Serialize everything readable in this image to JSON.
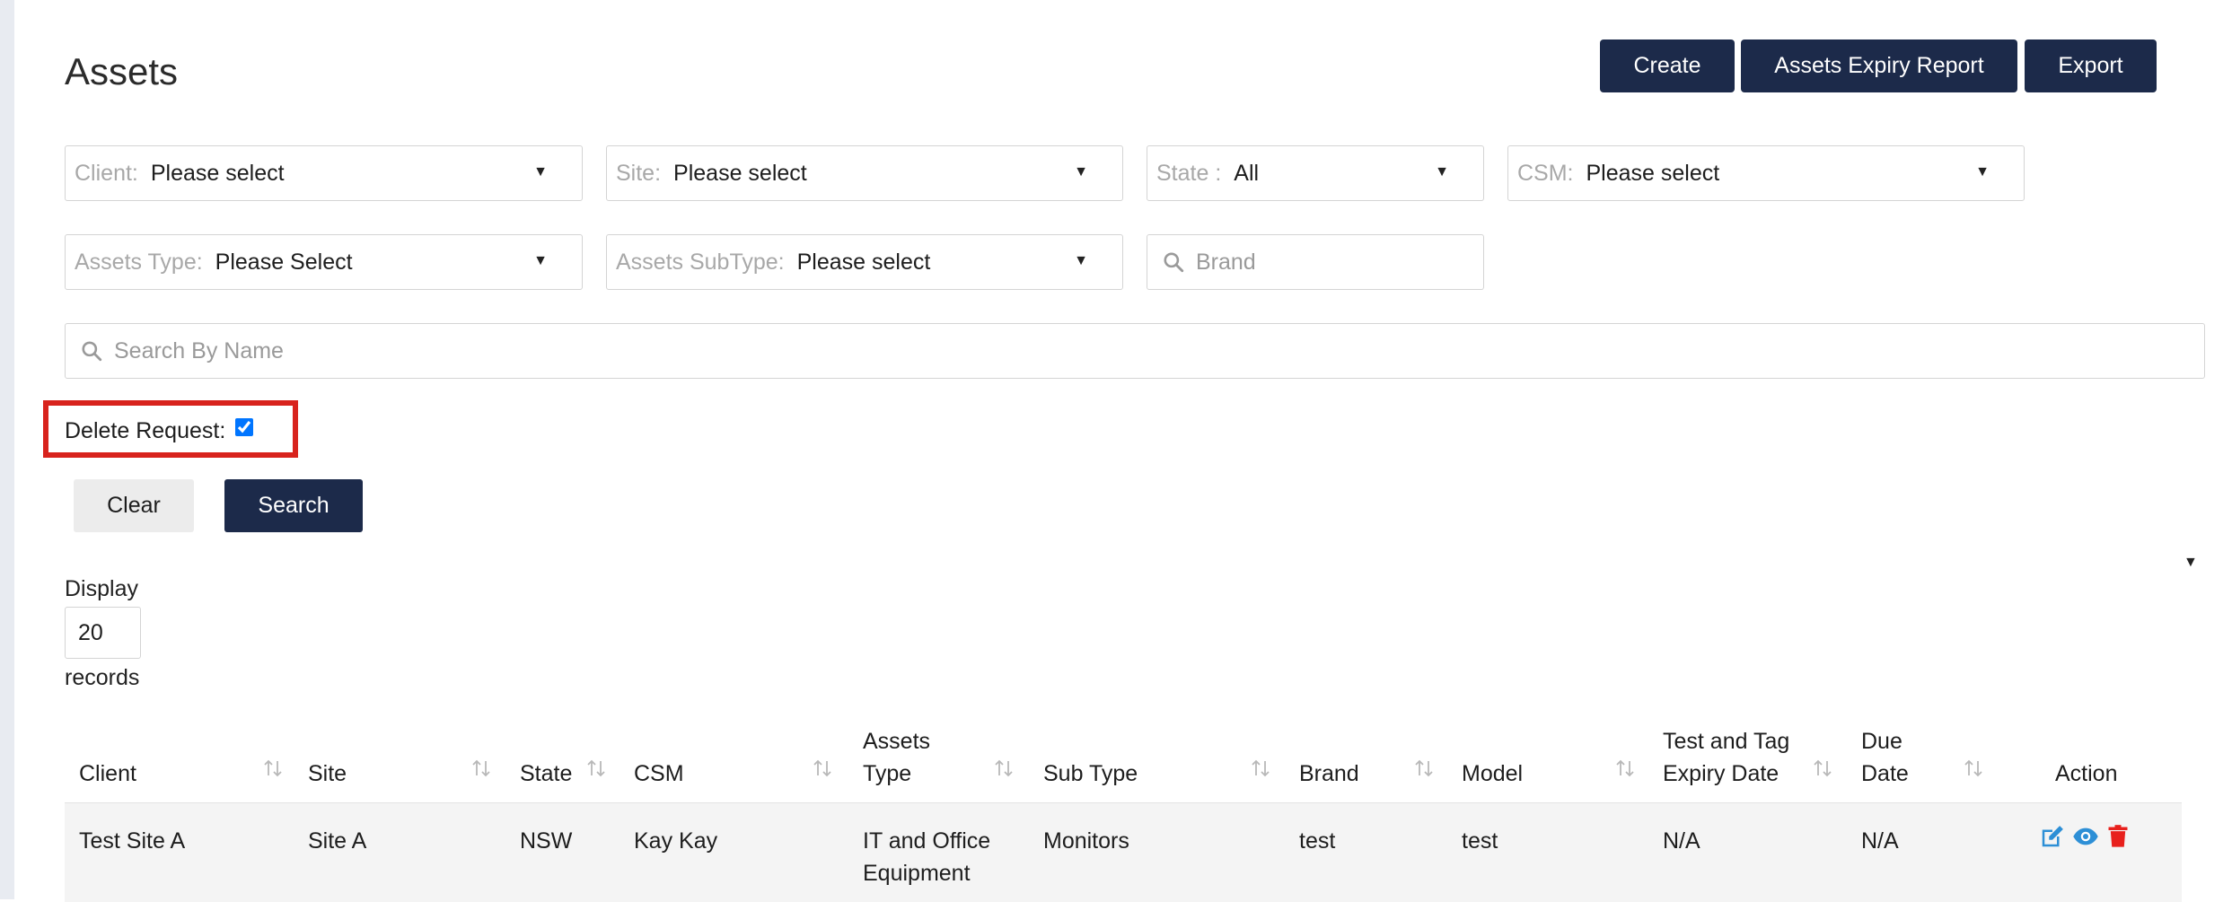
{
  "page": {
    "title": "Assets"
  },
  "toolbar": {
    "create_label": "Create",
    "expiry_report_label": "Assets Expiry Report",
    "export_label": "Export"
  },
  "filters": {
    "client": {
      "label": "Client:",
      "value": "Please select"
    },
    "site": {
      "label": "Site:",
      "value": "Please select"
    },
    "state": {
      "label": "State :",
      "value": "All"
    },
    "csm": {
      "label": "CSM:",
      "value": "Please select"
    },
    "assets_type": {
      "label": "Assets Type:",
      "value": "Please Select"
    },
    "assets_subtype": {
      "label": "Assets SubType:",
      "value": "Please select"
    },
    "brand": {
      "placeholder": "Brand"
    },
    "name_search": {
      "placeholder": "Search By Name"
    },
    "delete_request": {
      "label": "Delete Request:",
      "checked": true
    }
  },
  "actions": {
    "clear_label": "Clear",
    "search_label": "Search"
  },
  "paging": {
    "display_label": "Display",
    "page_size": "20",
    "records_label": "records"
  },
  "table": {
    "columns": [
      {
        "key": "client",
        "label": "Client"
      },
      {
        "key": "site",
        "label": "Site"
      },
      {
        "key": "state",
        "label": "State"
      },
      {
        "key": "csm",
        "label": "CSM"
      },
      {
        "key": "assets_type",
        "label_line1": "Assets",
        "label_line2": "Type"
      },
      {
        "key": "sub_type",
        "label": "Sub Type"
      },
      {
        "key": "brand",
        "label": "Brand"
      },
      {
        "key": "model",
        "label": "Model"
      },
      {
        "key": "expiry",
        "label_line1": "Test and Tag",
        "label_line2": "Expiry Date"
      },
      {
        "key": "due",
        "label_line1": "Due",
        "label_line2": "Date"
      },
      {
        "key": "action",
        "label": "Action"
      }
    ],
    "rows": [
      {
        "client": "Test Site A",
        "site": "Site A",
        "state": "NSW",
        "csm": "Kay Kay",
        "assets_type_line1": "IT and Office",
        "assets_type_line2": "Equipment",
        "sub_type": "Monitors",
        "brand": "test",
        "model": "test",
        "expiry": "N/A",
        "due": "N/A",
        "actions": [
          "edit-icon",
          "view-icon",
          "delete-icon"
        ]
      }
    ]
  },
  "colors": {
    "primary": "#1c2a4a",
    "highlight": "#d8231d",
    "edit": "#2d8fd6",
    "view": "#2d8fd6",
    "delete": "#e8201c"
  }
}
